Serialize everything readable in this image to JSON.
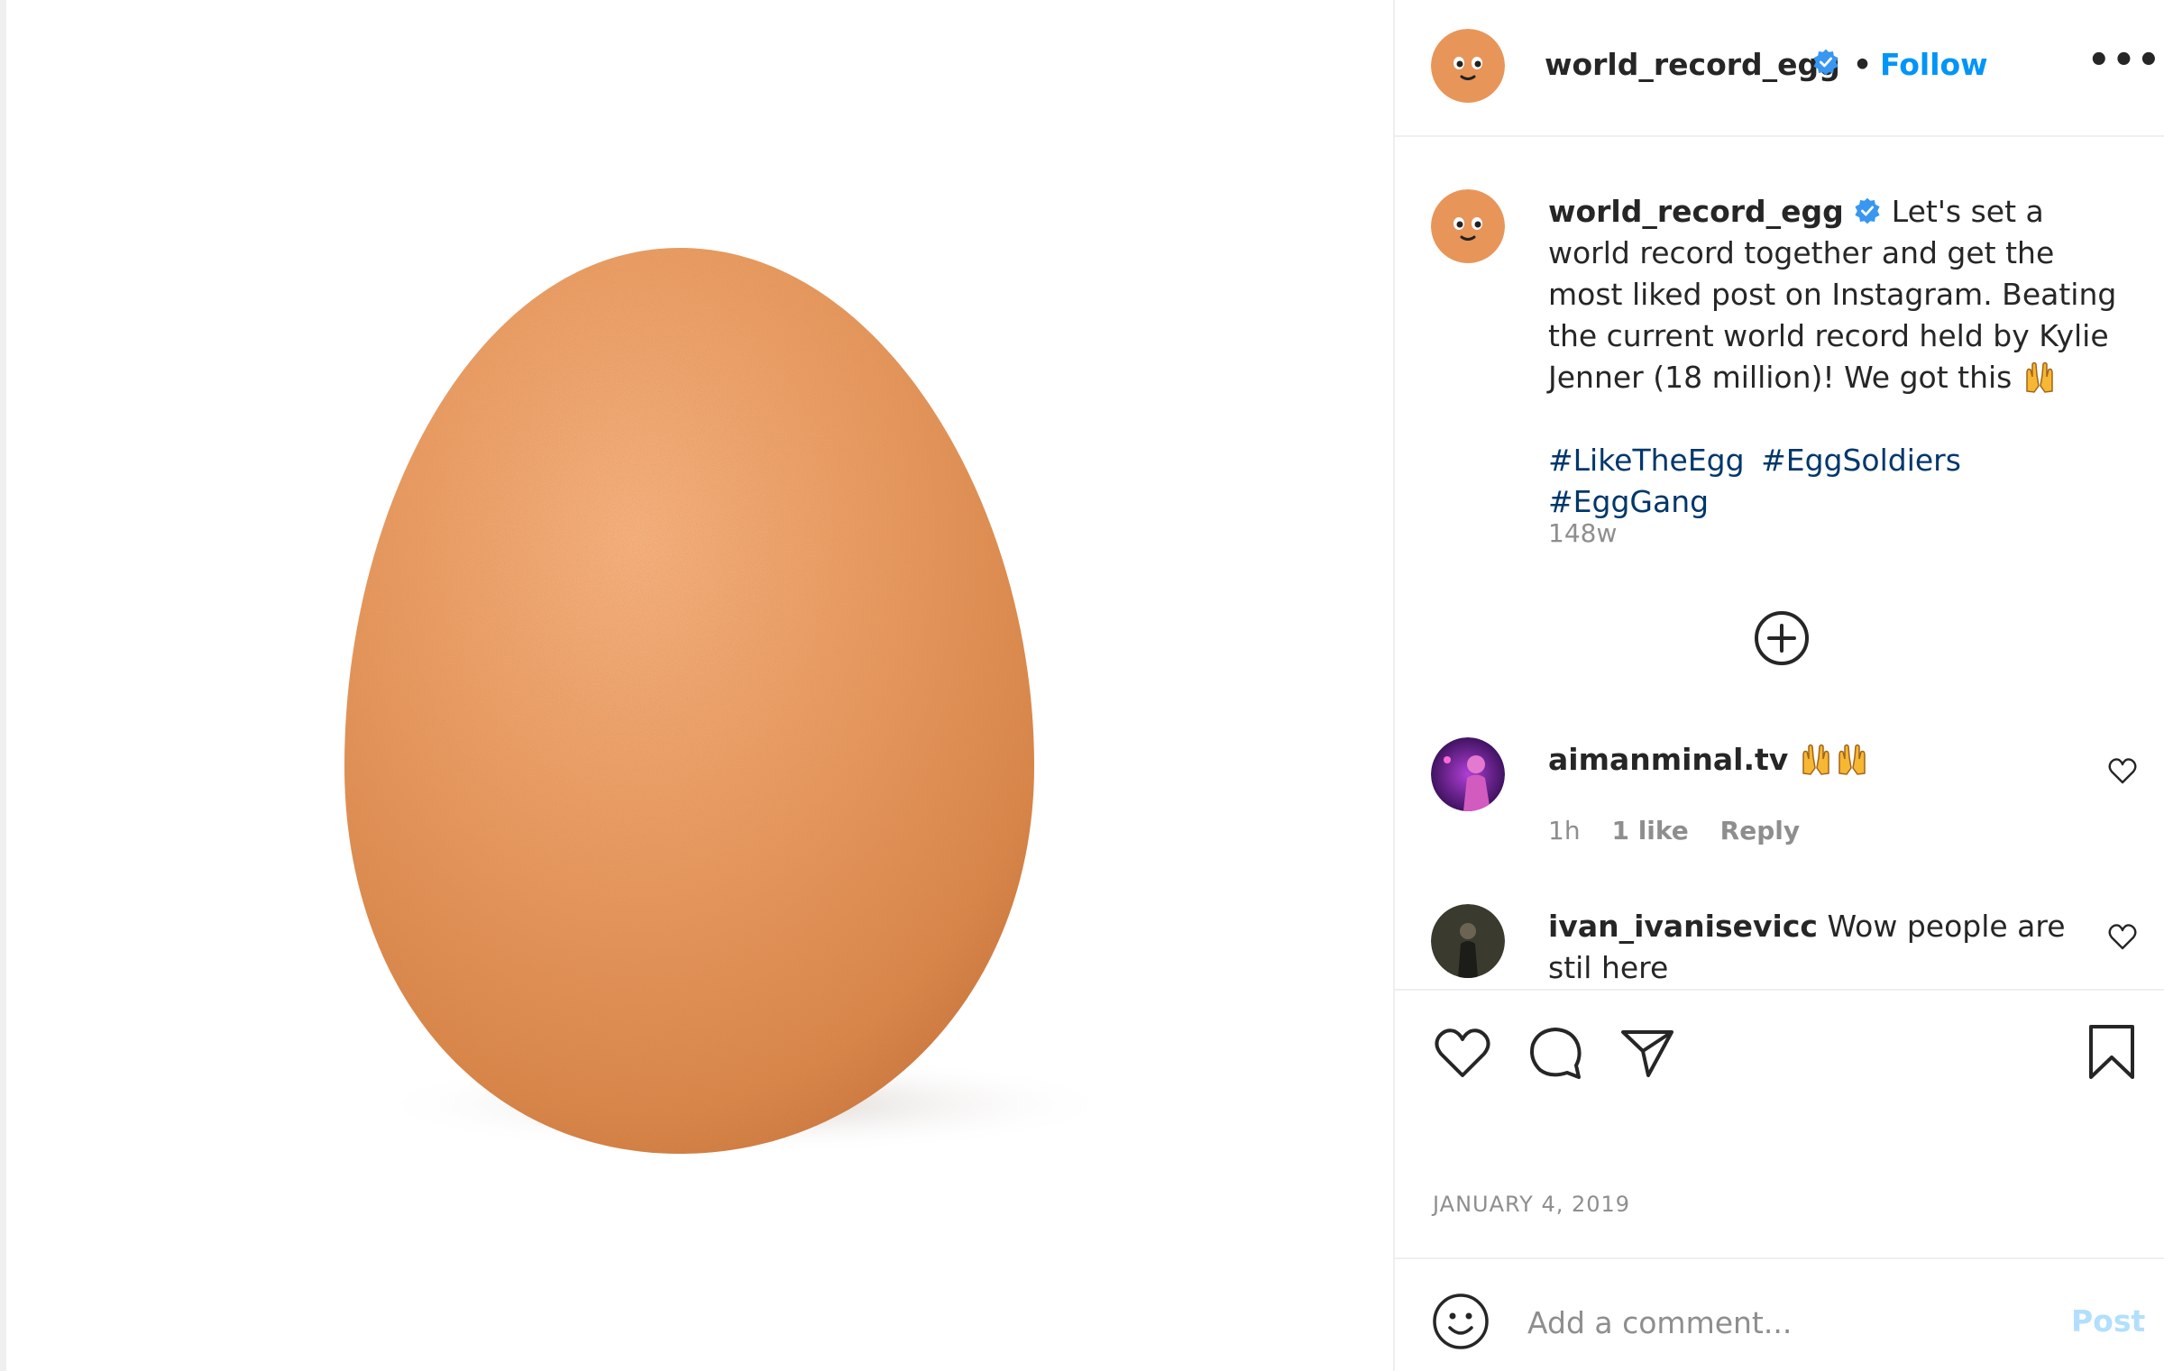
{
  "post": {
    "username": "world_record_egg",
    "follow_label": "Follow",
    "separator": "•",
    "more_label": "•••",
    "caption_text": "Let's set a world record together and get the most liked post on Instagram. Beating the current world record held by Kylie Jenner (18 million)! We got this",
    "hashtags": [
      "#LikeTheEgg",
      "#EggSoldiers",
      "#EggGang"
    ],
    "caption_age": "148w",
    "date": "JANUARY 4, 2019"
  },
  "comments": [
    {
      "username": "aimanminal.tv",
      "text": "",
      "age": "1h",
      "likes": "1 like",
      "reply": "Reply"
    },
    {
      "username": "ivan_ivanisevicc",
      "text": "Wow people are stil here"
    }
  ],
  "composer": {
    "placeholder": "Add a comment...",
    "post_label": "Post"
  },
  "icons": {
    "verified": "verified-badge-icon",
    "more": "more-options-icon",
    "load_more": "plus-circle-icon",
    "like": "heart-icon",
    "comment": "comment-bubble-icon",
    "share": "paper-plane-icon",
    "save": "bookmark-icon",
    "emoji": "smiley-icon",
    "clap": "raised-hands-emoji"
  },
  "colors": {
    "accent": "#0095f6",
    "link": "#00376b",
    "muted": "#8e8e8e",
    "post_disabled": "#b2dffc",
    "egg": "#e8955a"
  }
}
